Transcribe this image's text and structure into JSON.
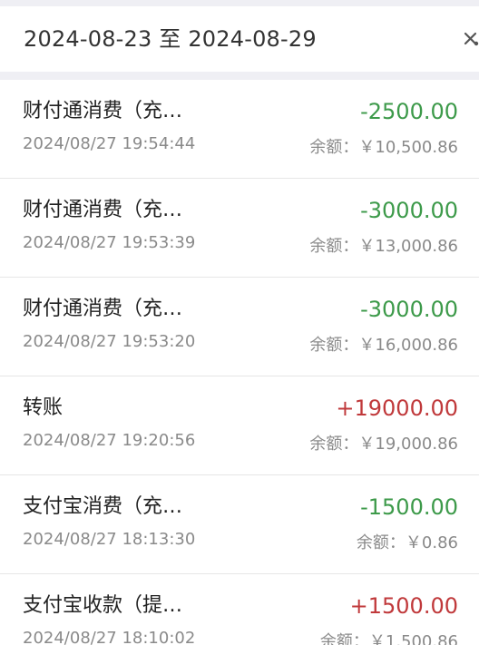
{
  "header": {
    "date_range": "2024-08-23 至 2024-08-29",
    "icon": "filter-tool-icon"
  },
  "transactions": [
    {
      "title": "财付通消费（充…",
      "time": "2024/08/27 19:54:44",
      "amount": "-2500.00",
      "direction": "out",
      "balance": "余额：￥10,500.86"
    },
    {
      "title": "财付通消费（充…",
      "time": "2024/08/27 19:53:39",
      "amount": "-3000.00",
      "direction": "out",
      "balance": "余额：￥13,000.86"
    },
    {
      "title": "财付通消费（充…",
      "time": "2024/08/27 19:53:20",
      "amount": "-3000.00",
      "direction": "out",
      "balance": "余额：￥16,000.86"
    },
    {
      "title": "转账",
      "time": "2024/08/27 19:20:56",
      "amount": "+19000.00",
      "direction": "in",
      "balance": "余额：￥19,000.86"
    },
    {
      "title": "支付宝消费（充…",
      "time": "2024/08/27 18:13:30",
      "amount": "-1500.00",
      "direction": "out",
      "balance": "余额：￥0.86"
    },
    {
      "title": "支付宝收款（提…",
      "time": "2024/08/27 18:10:02",
      "amount": "+1500.00",
      "direction": "in",
      "balance": "余额：￥1,500.86"
    }
  ],
  "colors": {
    "expense": "#3d9a4a",
    "income": "#c0393b",
    "background": "#efeff4"
  }
}
